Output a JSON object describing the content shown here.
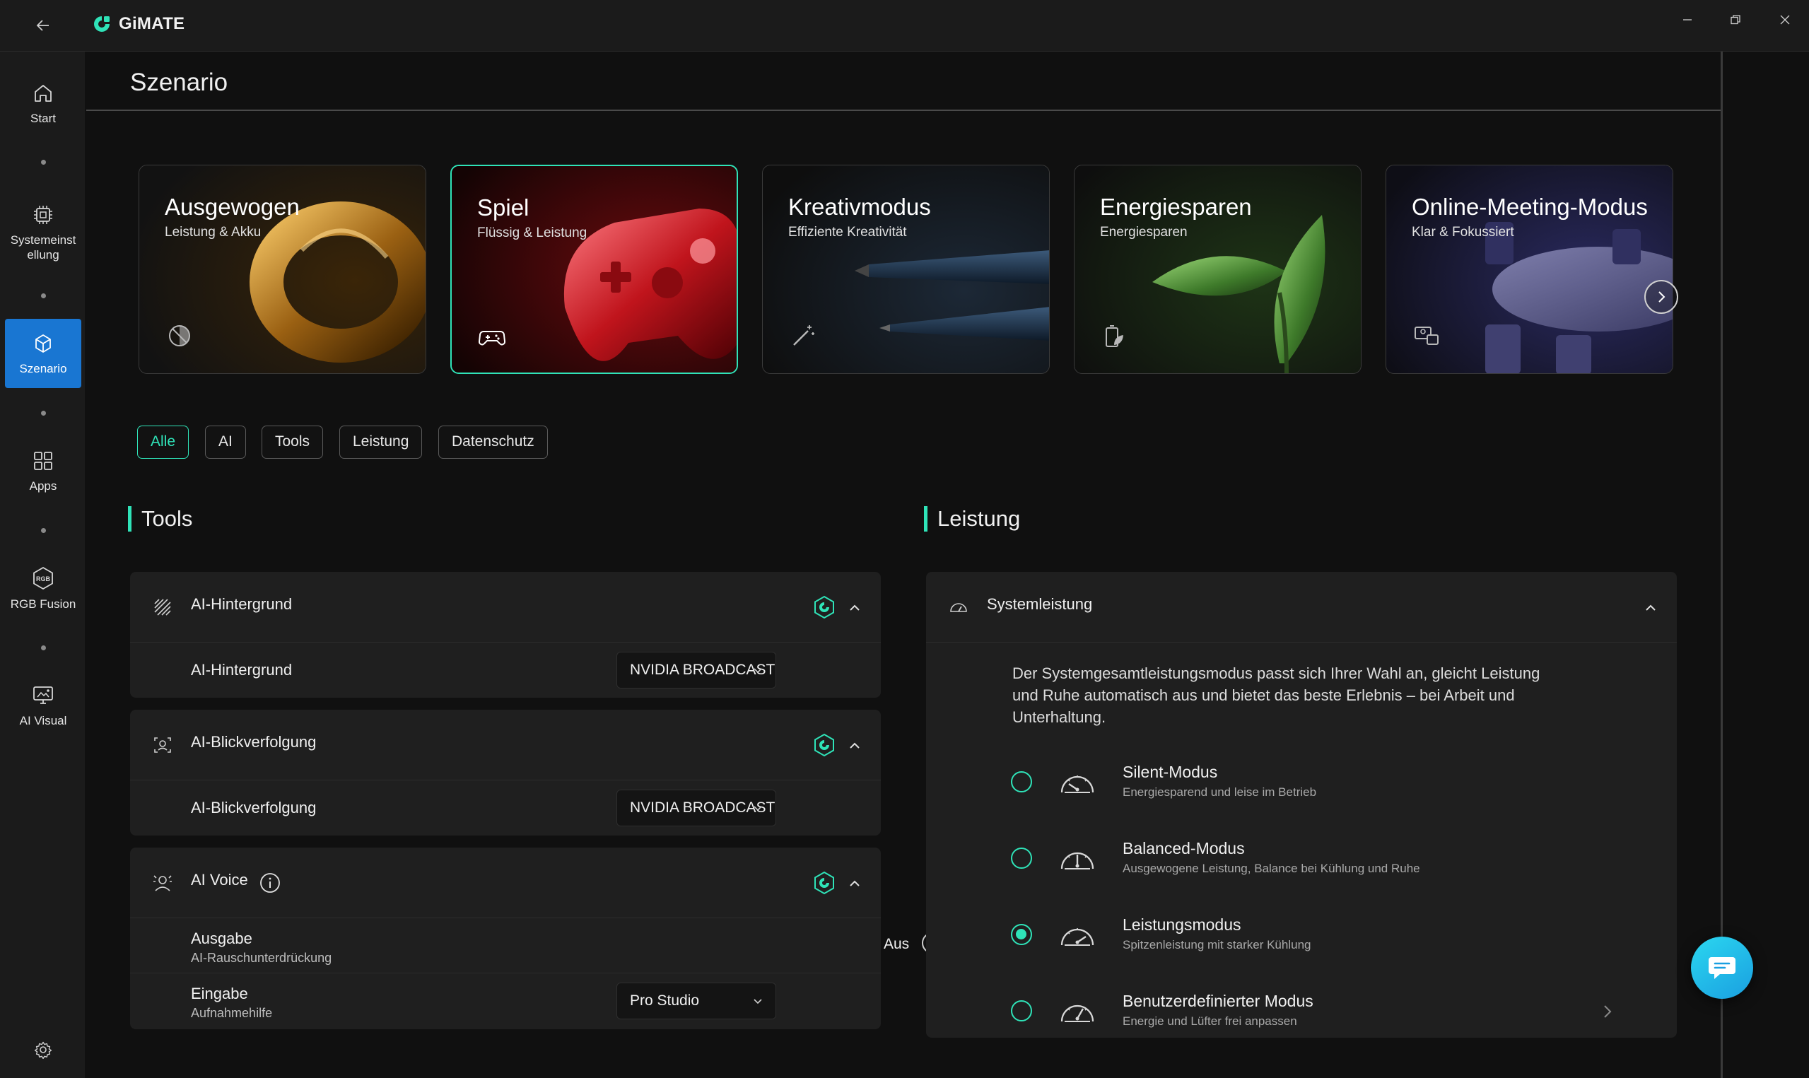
{
  "app": {
    "name": "GiMATE"
  },
  "window": {
    "back": "Zurück",
    "minimize": "Minimieren",
    "restore": "Wiederherstellen",
    "close": "Schließen"
  },
  "sidebar": {
    "items": [
      {
        "id": "start",
        "label": "Start",
        "icon": "home-icon"
      },
      {
        "id": "system",
        "label": "Systemeinst ellung",
        "icon": "chip-icon"
      },
      {
        "id": "scenario",
        "label": "Szenario",
        "icon": "cube-icon",
        "active": true
      },
      {
        "id": "apps",
        "label": "Apps",
        "icon": "grid-icon"
      },
      {
        "id": "rgb",
        "label": "RGB Fusion",
        "icon": "rgb-icon"
      },
      {
        "id": "aivisual",
        "label": "AI Visual",
        "icon": "ai-visual-icon"
      }
    ],
    "settings_icon": "gear-icon"
  },
  "page": {
    "title": "Szenario"
  },
  "scenarios": [
    {
      "title": "Ausgewogen",
      "subtitle": "Leistung & Akku",
      "icon": "balance-icon"
    },
    {
      "title": "Spiel",
      "subtitle": "Flüssig & Leistung",
      "icon": "gamepad-icon",
      "active": true
    },
    {
      "title": "Kreativmodus",
      "subtitle": "Effiziente Kreativität",
      "icon": "magic-wand-icon"
    },
    {
      "title": "Energiesparen",
      "subtitle": "Energiesparen",
      "icon": "battery-leaf-icon"
    },
    {
      "title": "Online-Meeting-Modus",
      "subtitle": "Klar & Fokussiert",
      "icon": "meeting-icon"
    }
  ],
  "filters": [
    "Alle",
    "AI",
    "Tools",
    "Leistung",
    "Datenschutz"
  ],
  "active_filter": "Alle",
  "tools": {
    "section_title": "Tools",
    "panels": [
      {
        "title": "AI-Hintergrund",
        "icon": "background-icon",
        "row_label": "AI-Hintergrund",
        "select_value": "NVIDIA BROADCAST"
      },
      {
        "title": "AI-Blickverfolgung",
        "icon": "eye-tracking-icon",
        "row_label": "AI-Blickverfolgung",
        "select_value": "NVIDIA BROADCAST"
      }
    ],
    "voice": {
      "title": "AI Voice",
      "output_label": "Ausgabe",
      "output_sub": "AI-Rauschunterdrückung",
      "toggle_label": "Aus",
      "toggle_on": false,
      "input_label": "Eingabe",
      "input_sub": "Aufnahmehilfe",
      "input_value": "Pro Studio"
    }
  },
  "performance": {
    "section_title": "Leistung",
    "panel_title": "Systemleistung",
    "description": "Der Systemgesamtleistungsmodus passt sich Ihrer Wahl an, gleicht Leistung und Ruhe automatisch aus und bietet das beste Erlebnis – bei Arbeit und Unterhaltung.",
    "modes": [
      {
        "name": "Silent-Modus",
        "desc": "Energiesparend und leise im Betrieb",
        "selected": false
      },
      {
        "name": "Balanced-Modus",
        "desc": "Ausgewogene Leistung, Balance bei Kühlung und Ruhe",
        "selected": false
      },
      {
        "name": "Leistungsmodus",
        "desc": "Spitzenleistung mit starker Kühlung",
        "selected": true
      },
      {
        "name": "Benutzerdefinierter Modus",
        "desc": "Energie und Lüfter frei anpassen",
        "selected": false
      }
    ]
  },
  "colors": {
    "accent": "#2fe3b8",
    "sidebar_active": "#1976d2",
    "background": "#101010",
    "panel": "#1f1f1f"
  }
}
